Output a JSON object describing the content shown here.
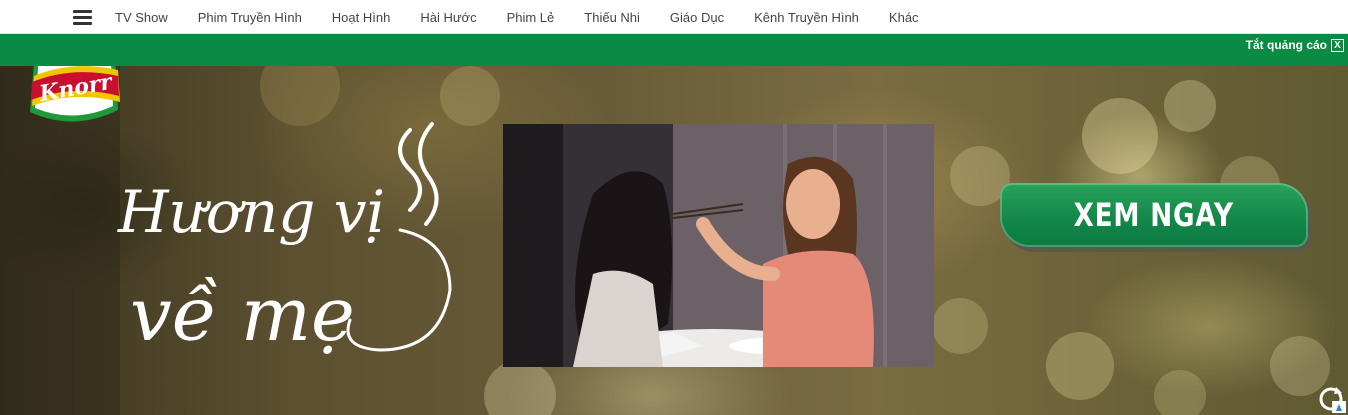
{
  "nav": {
    "items": [
      "TV Show",
      "Phim Truyền Hình",
      "Hoạt Hình",
      "Hài Hước",
      "Phim Lẻ",
      "Thiếu Nhi",
      "Giáo Dục",
      "Kênh Truyền Hình",
      "Khác"
    ]
  },
  "ad": {
    "close_label": "Tắt quảng cáo",
    "close_x": "X",
    "brand_logo_text": "Knorr",
    "slogan_line1": "Hương vị",
    "slogan_line2": "về mẹ",
    "cta_label": "XEM NGAY",
    "colors": {
      "green_strip": "#0b8a43",
      "cta_green": "#13884a",
      "brand_red": "#c8102e",
      "brand_yellow": "#f2c500"
    }
  },
  "icons": {
    "menu": "hamburger-menu-icon",
    "refresh": "refresh-icon"
  }
}
